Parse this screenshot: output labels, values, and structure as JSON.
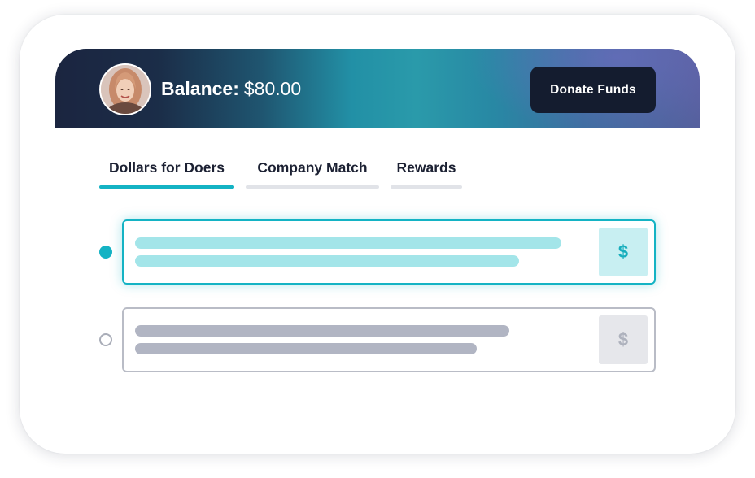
{
  "header": {
    "balance_label": "Balance:",
    "balance_amount": "$80.00",
    "donate_button": "Donate Funds"
  },
  "tabs": [
    {
      "label": "Dollars for Doers",
      "active": true
    },
    {
      "label": "Company Match",
      "active": false
    },
    {
      "label": "Rewards",
      "active": false
    }
  ],
  "options": [
    {
      "selected": true,
      "icon_symbol": "$"
    },
    {
      "selected": false,
      "icon_symbol": "$"
    }
  ],
  "colors": {
    "accent": "#14b3c4",
    "dark_button": "#141c2f",
    "muted": "#b1b5c3"
  }
}
